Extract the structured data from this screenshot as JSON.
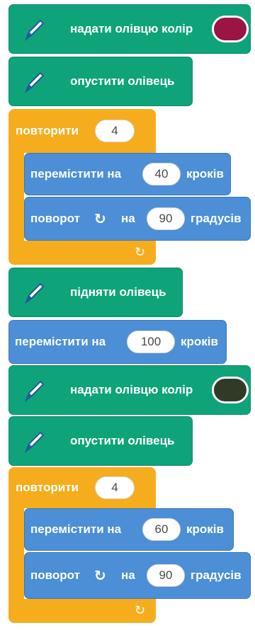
{
  "program": {
    "group1": {
      "set_color": {
        "label": "надати олівцю колір",
        "color": "#9a1444"
      },
      "pen_down": {
        "label": "опустити олівець"
      },
      "repeat": {
        "label": "повторити",
        "count": "4",
        "move": {
          "label": "перемістити на",
          "value": "40",
          "unit": "кроків"
        },
        "turn": {
          "label": "поворот",
          "on": "на",
          "value": "90",
          "unit": "градусів"
        }
      }
    },
    "pen_up": {
      "label": "підняти олівець"
    },
    "move_mid": {
      "label": "перемістити на",
      "value": "100",
      "unit": "кроків"
    },
    "group2": {
      "set_color": {
        "label": "надати олівцю колір",
        "color": "#303a26"
      },
      "pen_down": {
        "label": "опустити олівець"
      },
      "repeat": {
        "label": "повторити",
        "count": "4",
        "move": {
          "label": "перемістити на",
          "value": "60",
          "unit": "кроків"
        },
        "turn": {
          "label": "поворот",
          "on": "на",
          "value": "90",
          "unit": "градусів"
        }
      }
    }
  },
  "icons": {
    "pen": "pen-icon",
    "turn": "turn-right-icon",
    "loop": "loop-arrow-icon"
  },
  "colors": {
    "pen_block": "#0fa37a",
    "motion_block": "#4c8fd6",
    "control_block": "#f5ad1d"
  }
}
